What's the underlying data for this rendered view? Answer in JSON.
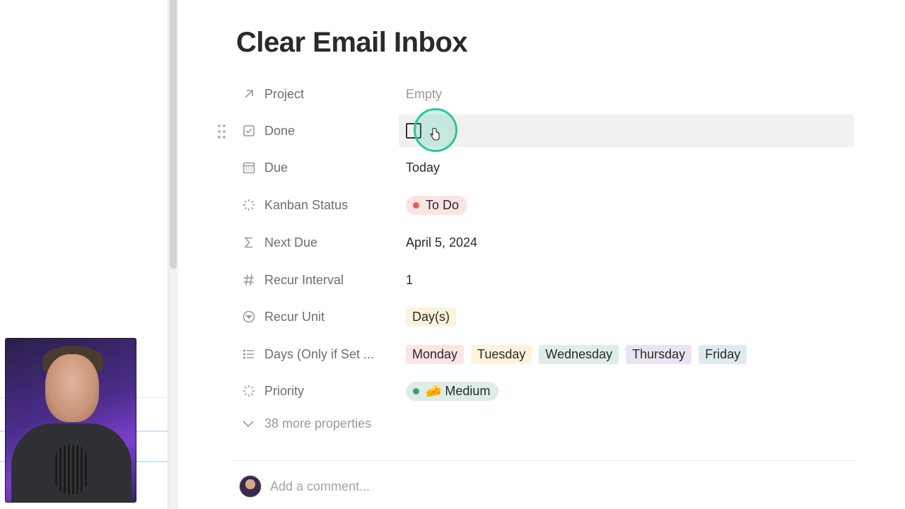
{
  "page": {
    "title": "Clear Email Inbox"
  },
  "properties": [
    {
      "label": "Project",
      "icon": "arrow-up-right-icon",
      "value": "Empty"
    },
    {
      "label": "Done",
      "icon": "checkbox-icon",
      "checked": false
    },
    {
      "label": "Due",
      "icon": "calendar-icon",
      "value": "Today"
    },
    {
      "label": "Kanban Status",
      "icon": "status-icon",
      "value": "To Do",
      "color": "#fbe4e4",
      "dot": "#e16259"
    },
    {
      "label": "Next Due",
      "icon": "sigma-icon",
      "value": "April 5, 2024"
    },
    {
      "label": "Recur Interval",
      "icon": "hash-icon",
      "value": "1"
    },
    {
      "label": "Recur Unit",
      "icon": "select-icon",
      "value": "Day(s)",
      "color": "#fbf3db"
    },
    {
      "label": "Days (Only if Set ...",
      "icon": "list-icon",
      "values": [
        {
          "label": "Monday",
          "color": "#fbe4e4"
        },
        {
          "label": "Tuesday",
          "color": "#fbf3db"
        },
        {
          "label": "Wednesday",
          "color": "#ddedea"
        },
        {
          "label": "Thursday",
          "color": "#eae4f2"
        },
        {
          "label": "Friday",
          "color": "#ddebf1"
        }
      ]
    },
    {
      "label": "Priority",
      "icon": "status-icon",
      "value": "🧀 Medium",
      "color": "#ddedea",
      "dot": "#4f9768"
    }
  ],
  "more_properties": "38 more properties",
  "comment": {
    "placeholder": "Add a comment..."
  }
}
